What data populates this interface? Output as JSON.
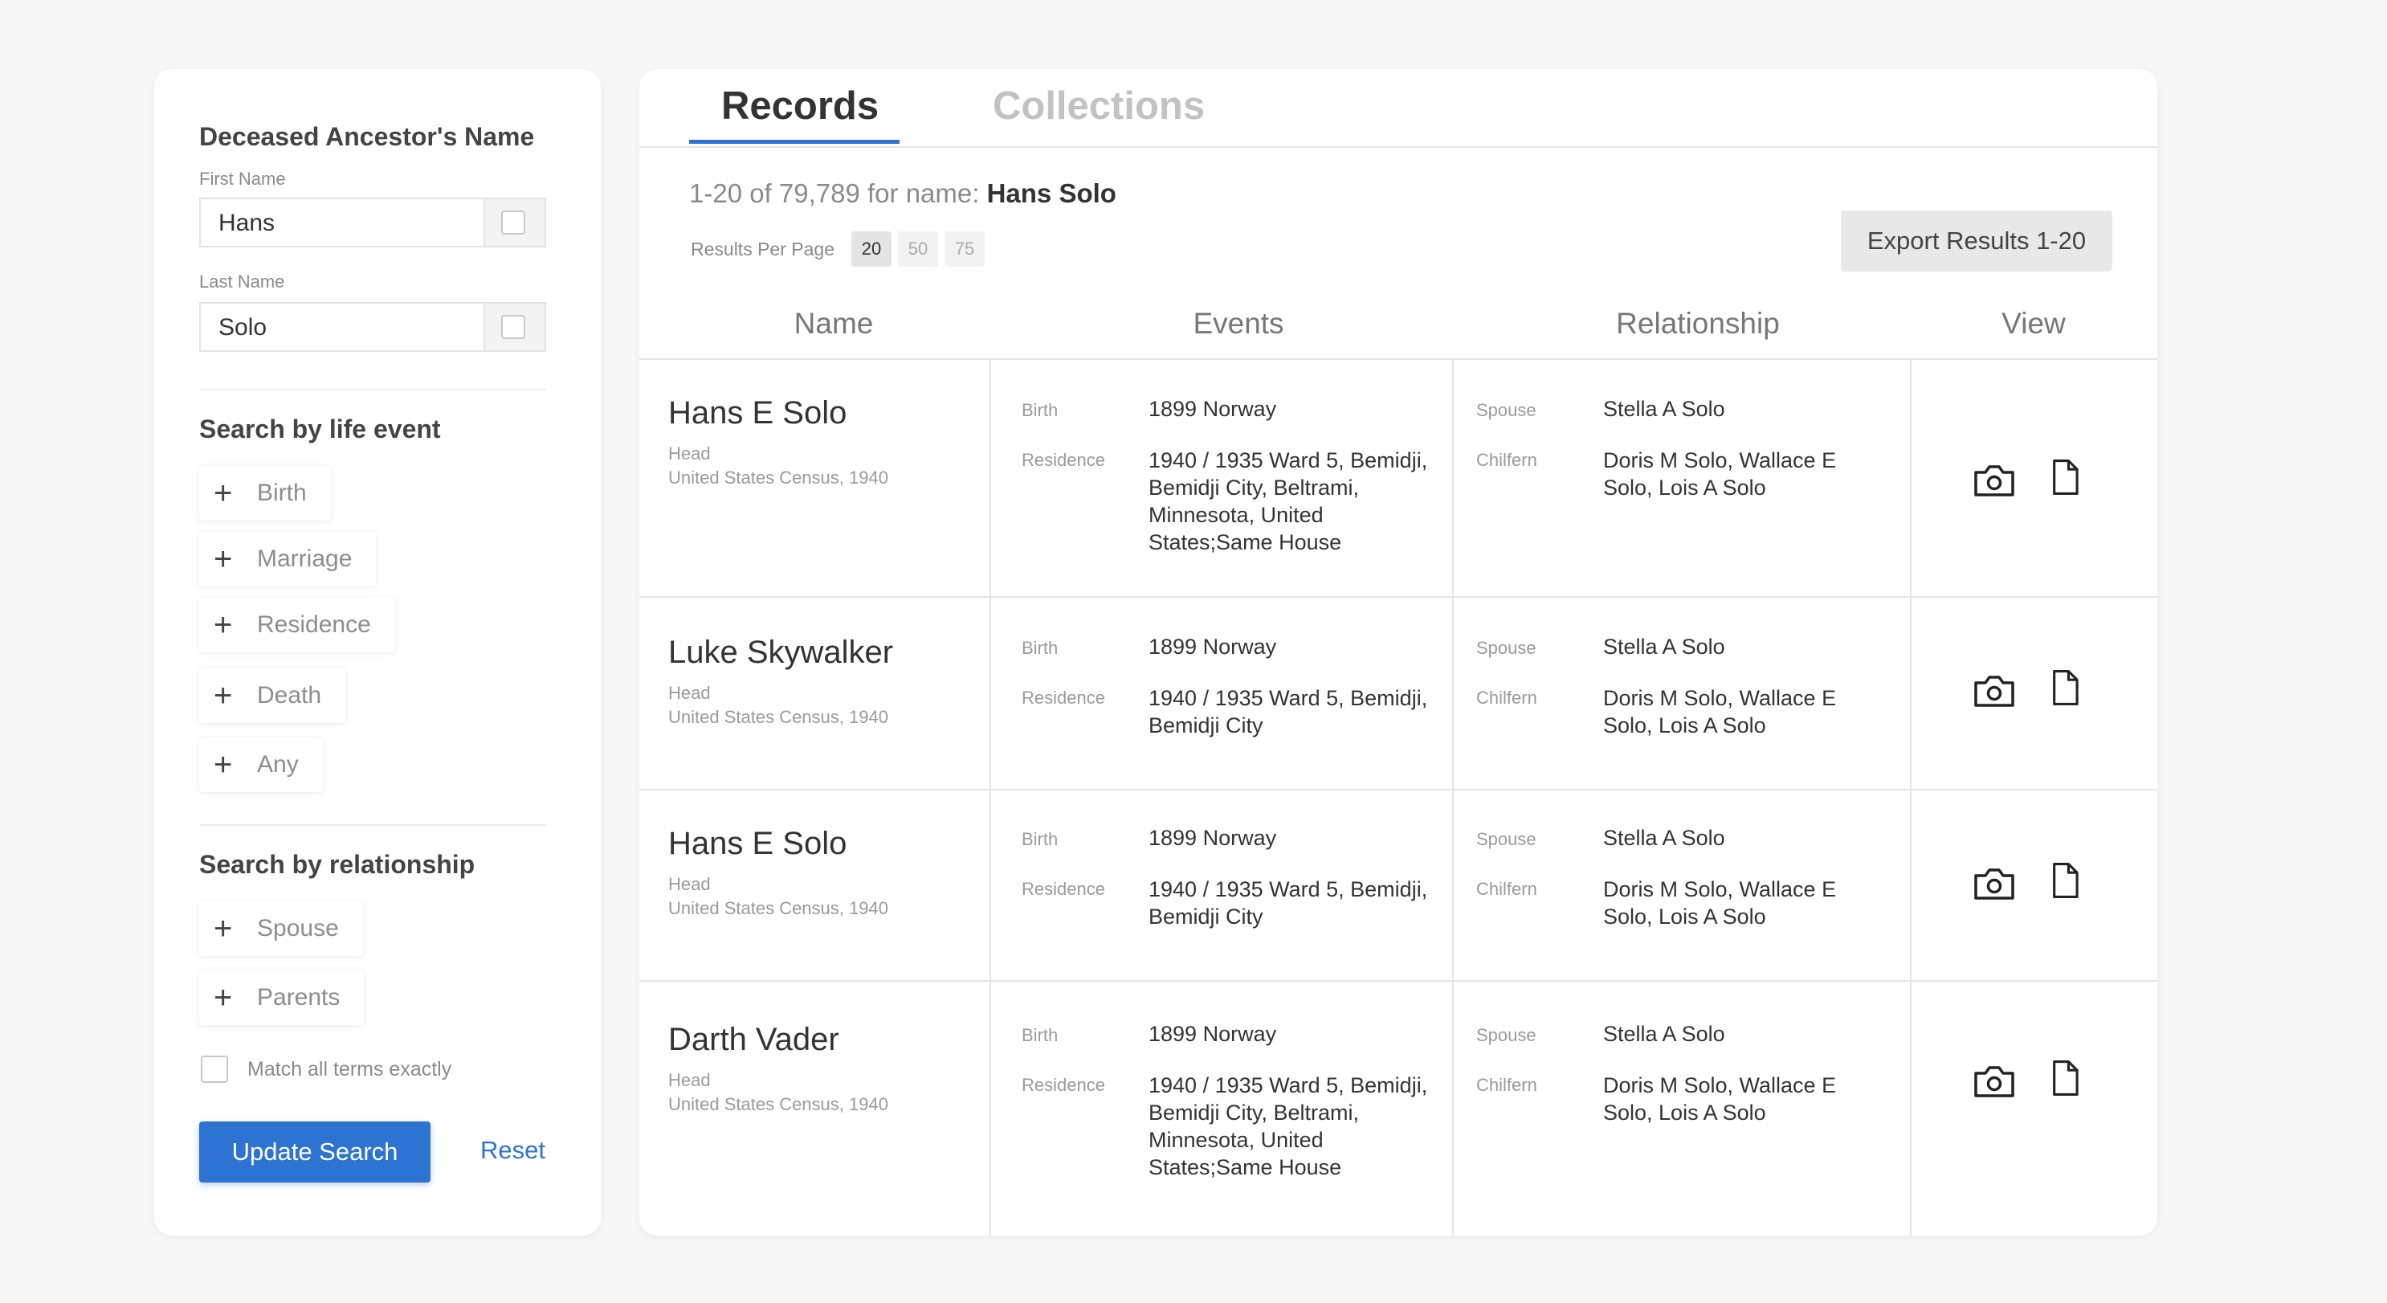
{
  "sidebar": {
    "name_heading": "Deceased Ancestor's Name",
    "first_name_label": "First Name",
    "first_name_value": "Hans",
    "last_name_label": "Last Name",
    "last_name_value": "Solo",
    "life_event_heading": "Search by life event",
    "life_events": [
      "Birth",
      "Marriage",
      "Residence",
      "Death",
      "Any"
    ],
    "relationship_heading": "Search by relationship",
    "relationships": [
      "Spouse",
      "Parents"
    ],
    "match_label": "Match all terms exactly",
    "update_label": "Update Search",
    "reset_label": "Reset"
  },
  "main": {
    "tabs": [
      {
        "label": "Records",
        "active": true
      },
      {
        "label": "Collections",
        "active": false
      }
    ],
    "results_prefix": "1-20 of 79,789 for name: ",
    "results_query": "Hans Solo",
    "per_page_label": "Results Per Page",
    "per_page_options": [
      "20",
      "50",
      "75"
    ],
    "per_page_selected": "20",
    "export_label": "Export Results 1-20",
    "columns": [
      "Name",
      "Events",
      "Relationship",
      "View"
    ],
    "rows": [
      {
        "name": "Hans E Solo",
        "role": "Head",
        "collection": "United States Census, 1940",
        "birth_label": "Birth",
        "birth": "1899 Norway",
        "residence_label": "Residence",
        "residence": "1940 / 1935   Ward 5, Bemidji, Bemidji City, Beltrami, Minnesota, United States;Same House",
        "spouse_label": "Spouse",
        "spouse": "Stella A Solo",
        "children_label": "Chilfern",
        "children": "Doris M Solo, Wallace E Solo, Lois A Solo"
      },
      {
        "name": "Luke Skywalker",
        "role": "Head",
        "collection": "United States Census, 1940",
        "birth_label": "Birth",
        "birth": "1899 Norway",
        "residence_label": "Residence",
        "residence": "1940 / 1935   Ward 5, Bemidji, Bemidji City",
        "spouse_label": "Spouse",
        "spouse": "Stella A Solo",
        "children_label": "Chilfern",
        "children": "Doris M Solo, Wallace E Solo, Lois A Solo"
      },
      {
        "name": "Hans E Solo",
        "role": "Head",
        "collection": "United States Census, 1940",
        "birth_label": "Birth",
        "birth": "1899 Norway",
        "residence_label": "Residence",
        "residence": "1940 / 1935   Ward 5, Bemidji, Bemidji City",
        "spouse_label": "Spouse",
        "spouse": "Stella A Solo",
        "children_label": "Chilfern",
        "children": "Doris M Solo, Wallace E Solo, Lois A Solo"
      },
      {
        "name": "Darth Vader",
        "role": "Head",
        "collection": "United States Census, 1940",
        "birth_label": "Birth",
        "birth": "1899 Norway",
        "residence_label": "Residence",
        "residence": "1940 / 1935   Ward 5, Bemidji, Bemidji City, Beltrami, Minnesota, United States;Same House",
        "spouse_label": "Spouse",
        "spouse": "Stella A Solo",
        "children_label": "Chilfern",
        "children": "Doris M Solo, Wallace E Solo, Lois A Solo"
      }
    ],
    "view_icons": [
      "camera-icon",
      "document-icon"
    ]
  },
  "colors": {
    "accent": "#2c73d2",
    "text": "#333333",
    "muted": "#9a9a9a",
    "background": "#f7f7f7"
  }
}
